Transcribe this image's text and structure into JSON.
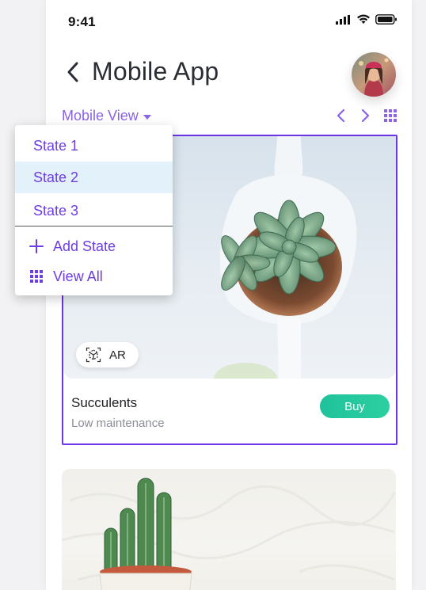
{
  "status": {
    "time": "9:41",
    "icons": [
      "signal-icon",
      "wifi-icon",
      "battery-icon"
    ]
  },
  "header": {
    "title": "Mobile App",
    "back_icon": "chevron-left-icon"
  },
  "view_selector": {
    "label": "Mobile View",
    "icon": "caret-down-icon"
  },
  "toolbar": {
    "icons": [
      "prev-arrow-icon",
      "next-arrow-icon",
      "grid-icon"
    ]
  },
  "dropdown": {
    "states": [
      {
        "label": "State 1",
        "active": false
      },
      {
        "label": "State 2",
        "active": true
      },
      {
        "label": "State 3",
        "active": false
      }
    ],
    "add_state": "Add State",
    "view_all": "View All"
  },
  "card": {
    "ar_label": "AR",
    "title": "Succulents",
    "subtitle": "Low maintenance",
    "buy_label": "Buy"
  },
  "colors": {
    "accent": "#6c3ee4",
    "buy": "#20c29c",
    "selected_item_bg": "#e3f1fb"
  }
}
